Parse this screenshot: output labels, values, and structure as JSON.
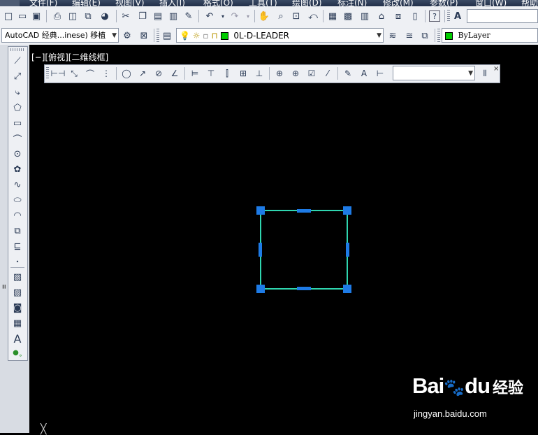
{
  "menu": {
    "items": [
      "文件(F)",
      "编辑(E)",
      "视图(V)",
      "插入(I)",
      "格式(O)",
      "工具(T)",
      "绘图(D)",
      "标注(N)",
      "修改(M)",
      "参数(P)",
      "窗口(W)",
      "帮助"
    ]
  },
  "workspace": {
    "value": "AutoCAD 经典...inese) 移植"
  },
  "layer": {
    "value": "0L-D-LEADER",
    "color": "#00cc00"
  },
  "color_combo": {
    "value": "ByLayer",
    "color": "#00cc00"
  },
  "viewport": {
    "label": "[−][俯视][二维线框]"
  },
  "dimstyle": {
    "value": ""
  },
  "watermark": {
    "brand": "Bai",
    "brand2": "du",
    "cn": "经验",
    "url": "jingyan.baidu.com"
  },
  "shape": {
    "line_color": "#2fd6b0",
    "grip_color": "#1e7be6"
  },
  "toolbars": {
    "standard_icons": [
      "new-icon",
      "open-icon",
      "save-icon",
      "print-icon",
      "print-preview-icon",
      "publish-icon",
      "3d-print-icon",
      "cut-icon",
      "copy-icon",
      "paste-icon",
      "match-properties-icon",
      "undo-icon",
      "redo-icon",
      "pan-icon",
      "zoom-realtime-icon",
      "zoom-window-icon",
      "zoom-previous-icon",
      "properties-icon",
      "design-center-icon",
      "tool-palettes-icon",
      "markup-icon",
      "calc-icon",
      "help-icon",
      "text-style-icon"
    ],
    "draw_icons": [
      "line-icon",
      "construction-line-icon",
      "polyline-icon",
      "polygon-icon",
      "rectangle-icon",
      "arc-icon",
      "circle-icon",
      "revision-cloud-icon",
      "spline-icon",
      "ellipse-icon",
      "ellipse-arc-icon",
      "insert-block-icon",
      "make-block-icon",
      "point-icon",
      "hatch-icon",
      "gradient-icon",
      "region-icon",
      "table-icon",
      "mtext-icon",
      "add-selected-icon"
    ],
    "dim_icons": [
      "linear-dim-icon",
      "aligned-dim-icon",
      "arc-length-icon",
      "ordinate-dim-icon",
      "radius-dim-icon",
      "jogged-dim-icon",
      "diameter-dim-icon",
      "angular-dim-icon",
      "quick-dim-icon",
      "baseline-dim-icon",
      "continue-dim-icon",
      "dim-space-icon",
      "dim-break-icon",
      "tolerance-icon",
      "center-mark-icon",
      "inspection-icon",
      "jogged-linear-icon",
      "dim-edit-icon",
      "dim-text-edit-icon",
      "dim-update-icon",
      "dim-style-icon"
    ]
  }
}
